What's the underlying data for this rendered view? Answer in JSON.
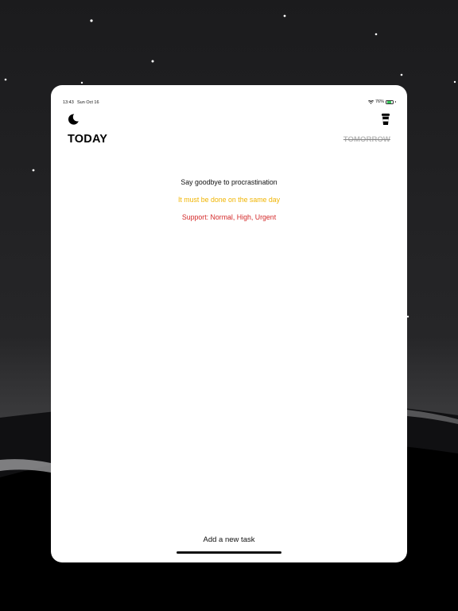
{
  "status_bar": {
    "time": "13:43",
    "date": "Sun Oct 16",
    "battery": "76%",
    "battery_level": 0.76
  },
  "header": {
    "left_icon": "moon-icon",
    "right_icon": "coffee-cup-icon"
  },
  "tabs": {
    "today": "TODAY",
    "tomorrow": "TOMORROW"
  },
  "hints": {
    "line1": "Say goodbye to procrastination",
    "line2": "It must be done on the same day",
    "line3": "Support: Normal, High, Urgent"
  },
  "footer": {
    "add_task_label": "Add a new task"
  },
  "colors": {
    "background": "#1f1f21",
    "hint_warning": "#f0b400",
    "hint_urgent": "#d42a2a",
    "tab_inactive": "#b7b7b7"
  }
}
